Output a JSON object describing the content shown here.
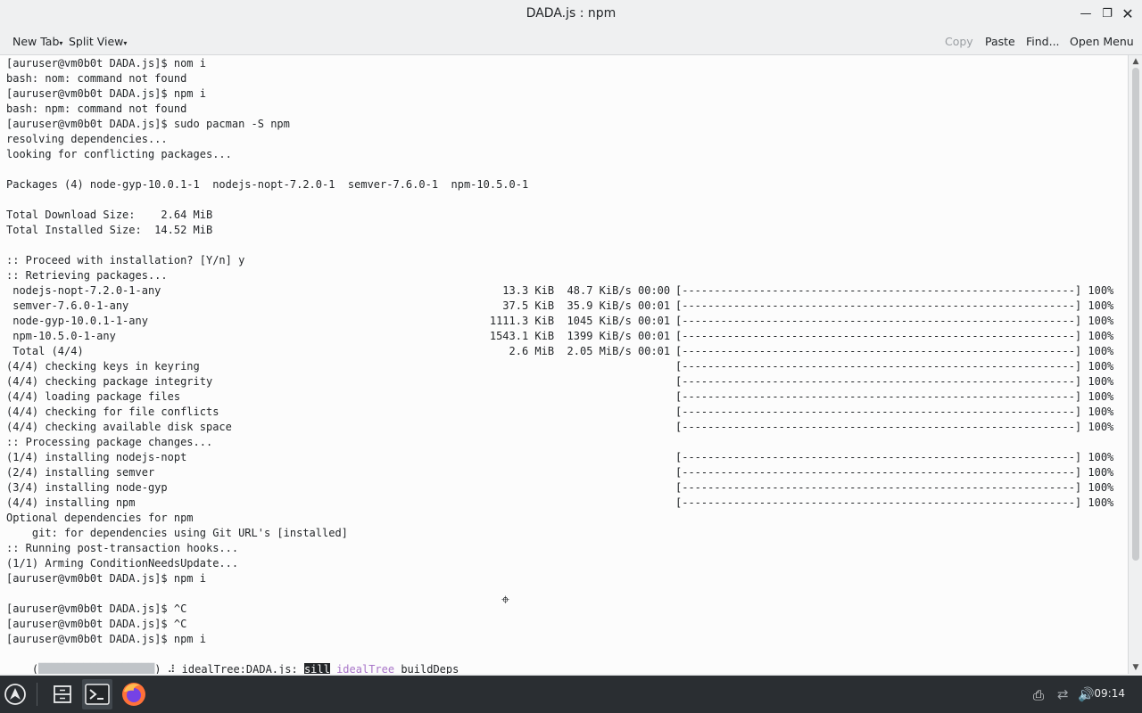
{
  "window": {
    "title": "DADA.js : npm"
  },
  "toolbar": {
    "new_tab": "New Tab",
    "split_view": "Split View",
    "copy": "Copy",
    "paste": "Paste",
    "find": "Find...",
    "open_menu": "Open Menu"
  },
  "terminal": {
    "lines": [
      "[auruser@vm0b0t DADA.js]$ nom i",
      "bash: nom: command not found",
      "[auruser@vm0b0t DADA.js]$ npm i",
      "bash: npm: command not found",
      "[auruser@vm0b0t DADA.js]$ sudo pacman -S npm",
      "resolving dependencies...",
      "looking for conflicting packages...",
      "",
      "Packages (4) node-gyp-10.0.1-1  nodejs-nopt-7.2.0-1  semver-7.6.0-1  npm-10.5.0-1",
      "",
      "Total Download Size:    2.64 MiB",
      "Total Installed Size:  14.52 MiB",
      "",
      ":: Proceed with installation? [Y/n] y",
      ":: Retrieving packages...",
      " nodejs-nopt-7.2.0-1-any                                                     13.3 KiB  48.7 KiB/s 00:00",
      " semver-7.6.0-1-any                                                          37.5 KiB  35.9 KiB/s 00:01",
      " node-gyp-10.0.1-1-any                                                     1111.3 KiB  1045 KiB/s 00:01",
      " npm-10.5.0-1-any                                                          1543.1 KiB  1399 KiB/s 00:01",
      " Total (4/4)                                                                  2.6 MiB  2.05 MiB/s 00:01",
      "(4/4) checking keys in keyring",
      "(4/4) checking package integrity",
      "(4/4) loading package files",
      "(4/4) checking for file conflicts",
      "(4/4) checking available disk space",
      ":: Processing package changes...",
      "(1/4) installing nodejs-nopt",
      "(2/4) installing semver",
      "(3/4) installing node-gyp",
      "(4/4) installing npm",
      "Optional dependencies for npm",
      "    git: for dependencies using Git URL's [installed]",
      ":: Running post-transaction hooks...",
      "(1/1) Arming ConditionNeedsUpdate...",
      "[auruser@vm0b0t DADA.js]$ npm i",
      "",
      "[auruser@vm0b0t DADA.js]$ ^C",
      "[auruser@vm0b0t DADA.js]$ ^C",
      "[auruser@vm0b0t DADA.js]$ npm i"
    ],
    "progress_bar": "[-------------------------------------------------------------] 100%",
    "progress_rows": [
      15,
      16,
      17,
      18,
      19,
      20,
      21,
      22,
      23,
      24,
      26,
      27,
      28,
      29
    ],
    "last_line": {
      "open_paren": "(",
      "close_paren": ") ",
      "spinner": "⠼",
      "text1": " idealTree:DADA.js: ",
      "sill": "sill",
      "purple": " idealTree",
      "rest": " buildDeps"
    }
  },
  "taskbar": {
    "clock": "09:14",
    "icons": [
      "arch-menu-icon",
      "file-manager-icon",
      "terminal-icon",
      "firefox-icon"
    ]
  }
}
